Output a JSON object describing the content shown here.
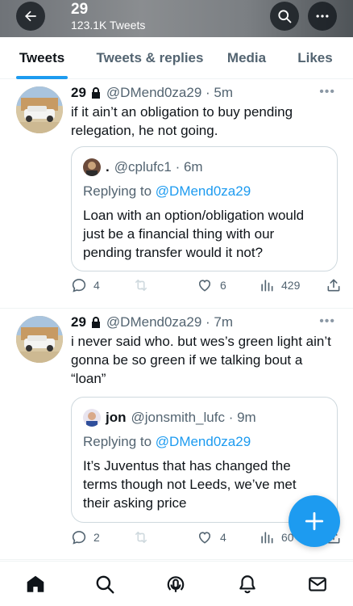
{
  "header": {
    "title": "29",
    "subtitle": "123.1K Tweets"
  },
  "tabs": [
    {
      "label": "Tweets",
      "active": true
    },
    {
      "label": "Tweets & replies",
      "active": false
    },
    {
      "label": "Media",
      "active": false
    },
    {
      "label": "Likes",
      "active": false
    }
  ],
  "tweets": [
    {
      "name": "29",
      "handle": "@DMend0za29 · 5m",
      "text": "if it ain’t an obligation to buy pending relegation, he not going.",
      "quote": {
        "name": ".",
        "handle": "@cplufc1 · 6m",
        "replying_prefix": "Replying to ",
        "replying_to": "@DMend0za29",
        "text": "Loan with an option/obligation would just be a financial thing with our pending transfer would it not?"
      },
      "replies": "4",
      "retweets": "",
      "likes": "6",
      "views": "429"
    },
    {
      "name": "29",
      "handle": "@DMend0za29 · 7m",
      "text": "i never said who. but wes’s green light ain’t gonna be so green if we talking bout a “loan”",
      "quote": {
        "name": "jon",
        "handle": "@jonsmith_lufc · 9m",
        "replying_prefix": "Replying to ",
        "replying_to": "@DMend0za29",
        "text": "It’s Juventus that has changed the terms though not Leeds, we’ve met their asking price"
      },
      "replies": "2",
      "retweets": "",
      "likes": "4",
      "views": "60"
    }
  ],
  "icons": {
    "back": "arrow-left-icon",
    "search": "search-icon",
    "more": "more-icon",
    "compose": "plus-icon",
    "nav": [
      "home-icon",
      "search-icon",
      "spaces-icon",
      "notifications-icon",
      "messages-icon"
    ]
  },
  "colors": {
    "accent": "#1d9bf0",
    "text": "#0f1419",
    "secondary": "#536471"
  }
}
